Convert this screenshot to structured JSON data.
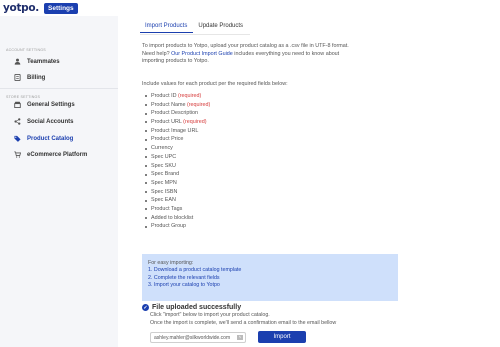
{
  "header": {
    "logo": "yotpo.",
    "settings_label": "Settings"
  },
  "sidebar": {
    "account_section": "ACCOUNT SETTINGS",
    "account_items": [
      {
        "label": "Teammates",
        "icon": "user-icon"
      },
      {
        "label": "Billing",
        "icon": "billing-icon"
      }
    ],
    "store_section": "STORE SETTINGS",
    "store_items": [
      {
        "label": "General Settings",
        "icon": "store-icon"
      },
      {
        "label": "Social Accounts",
        "icon": "share-icon"
      },
      {
        "label": "Product Catalog",
        "icon": "tag-icon"
      },
      {
        "label": "eCommerce Platform",
        "icon": "cart-icon"
      }
    ],
    "active_item": "Product Catalog"
  },
  "tabs": [
    {
      "label": "Import Products"
    },
    {
      "label": "Update Products"
    }
  ],
  "active_tab": "Import Products",
  "intro": {
    "line1": "To import products to Yotpo, upload your product catalog as a .csv file in UTF-8 format.",
    "line2_prefix": "Need help? ",
    "line2_link": "Our Product Import Guide",
    "line2_suffix": " includes everything you need to know about",
    "line3": "importing products to Yotpo."
  },
  "include_text": "Include values for each product per the required fields below:",
  "required_label": "(required)",
  "fields": [
    {
      "name": "Product ID",
      "required": true
    },
    {
      "name": "Product Name",
      "required": true
    },
    {
      "name": "Product Description",
      "required": false
    },
    {
      "name": "Product URL",
      "required": true
    },
    {
      "name": "Product Image URL",
      "required": false
    },
    {
      "name": "Product Price",
      "required": false
    },
    {
      "name": "Currency",
      "required": false
    },
    {
      "name": "Spec UPC",
      "required": false
    },
    {
      "name": "Spec SKU",
      "required": false
    },
    {
      "name": "Spec Brand",
      "required": false
    },
    {
      "name": "Spec MPN",
      "required": false
    },
    {
      "name": "Spec ISBN",
      "required": false
    },
    {
      "name": "Spec EAN",
      "required": false
    },
    {
      "name": "Product Tags",
      "required": false
    },
    {
      "name": "Added to blocklist",
      "required": false
    },
    {
      "name": "Product Group",
      "required": false
    }
  ],
  "infobox": {
    "title": "For easy importing:",
    "step1": "1. Download a product catalog template",
    "step2": "2. Complete the relevant fields",
    "step3": "3. Import your catalog to Yotpo"
  },
  "upload": {
    "title": "File uploaded successfully",
    "sub1": "Click \"import\" below to import your product catalog.",
    "sub2": "Once the import is complete, we'll send a confirmation email to the email bellow",
    "email_value": "ashley.mahler@silkworldwide.com",
    "import_label": "Import"
  },
  "colors": {
    "brand": "#1b3faf",
    "required": "#d63b3b",
    "info_bg": "#cfe0fb"
  }
}
